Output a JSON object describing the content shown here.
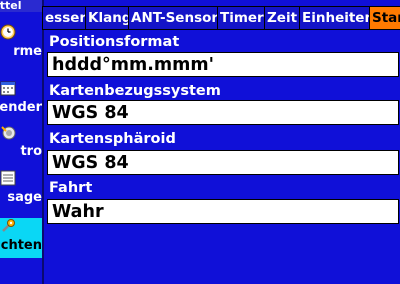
{
  "sidebar": {
    "header": "ittel",
    "items": [
      {
        "label": "rme",
        "icon": "clock-icon"
      },
      {
        "label": "ender",
        "icon": "calendar-icon"
      },
      {
        "label": "tro",
        "icon": "tools-icon"
      },
      {
        "label": "sage",
        "icon": "notepad-icon"
      },
      {
        "label": "chten",
        "icon": "wrench-icon"
      }
    ]
  },
  "tabs": [
    {
      "label": "esser"
    },
    {
      "label": "Klang"
    },
    {
      "label": "ANT-Sensor"
    },
    {
      "label": "Timer"
    },
    {
      "label": "Zeit"
    },
    {
      "label": "Einheiten"
    },
    {
      "label": "Stan"
    }
  ],
  "fields": [
    {
      "label": "Positionsformat",
      "value": "hddd°mm.mmm'"
    },
    {
      "label": "Kartenbezugssystem",
      "value": "WGS 84"
    },
    {
      "label": "Kartensphäroid",
      "value": "WGS 84"
    },
    {
      "label": "Fahrt",
      "value": "Wahr"
    }
  ],
  "colors": {
    "background": "#1010d8",
    "active_tab": "#ff7a00",
    "active_sidebar": "#0ad7f5"
  }
}
